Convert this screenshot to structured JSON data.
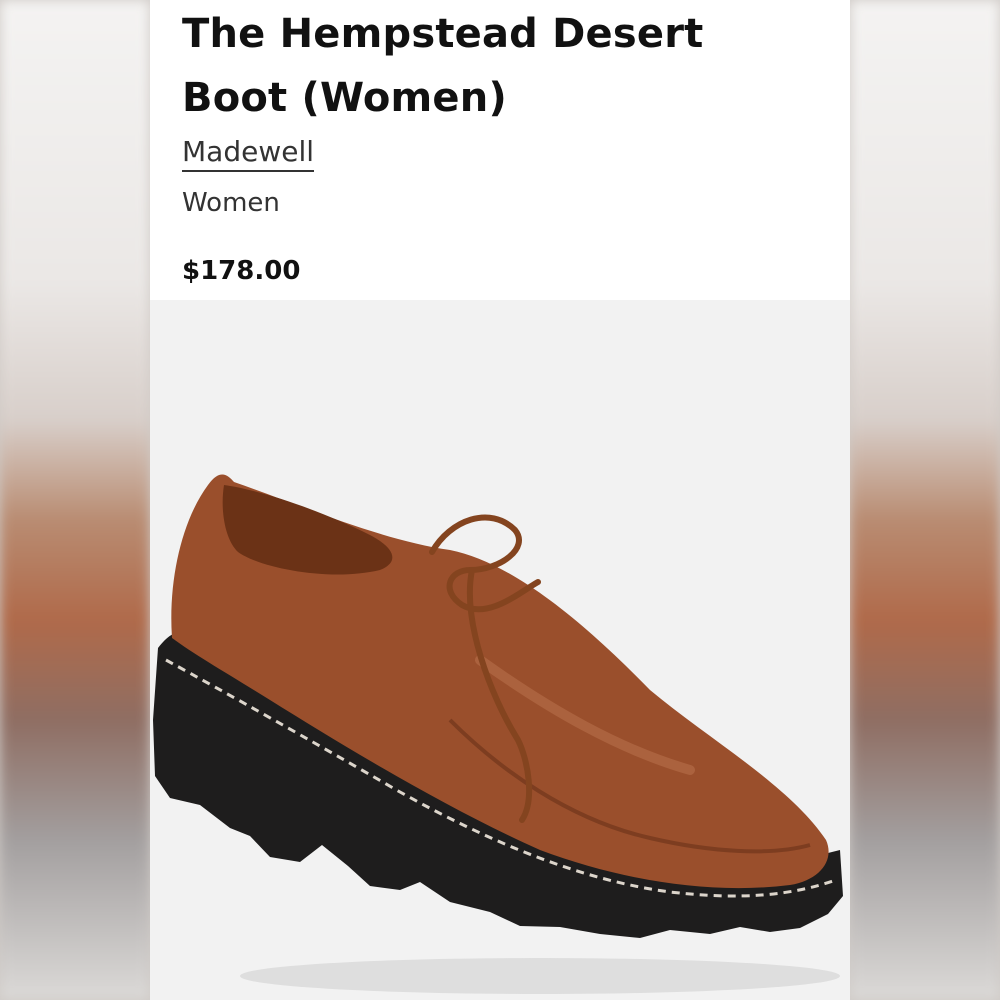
{
  "product": {
    "title": "The Hempstead Desert Boot (Women)",
    "brand": "Madewell",
    "category": "Women",
    "price": "$178.00"
  },
  "image": {
    "subject": "brown leather lace-up shoe with black lug sole",
    "upper_color": "#9a4f2c",
    "sole_color": "#1e1d1d"
  }
}
